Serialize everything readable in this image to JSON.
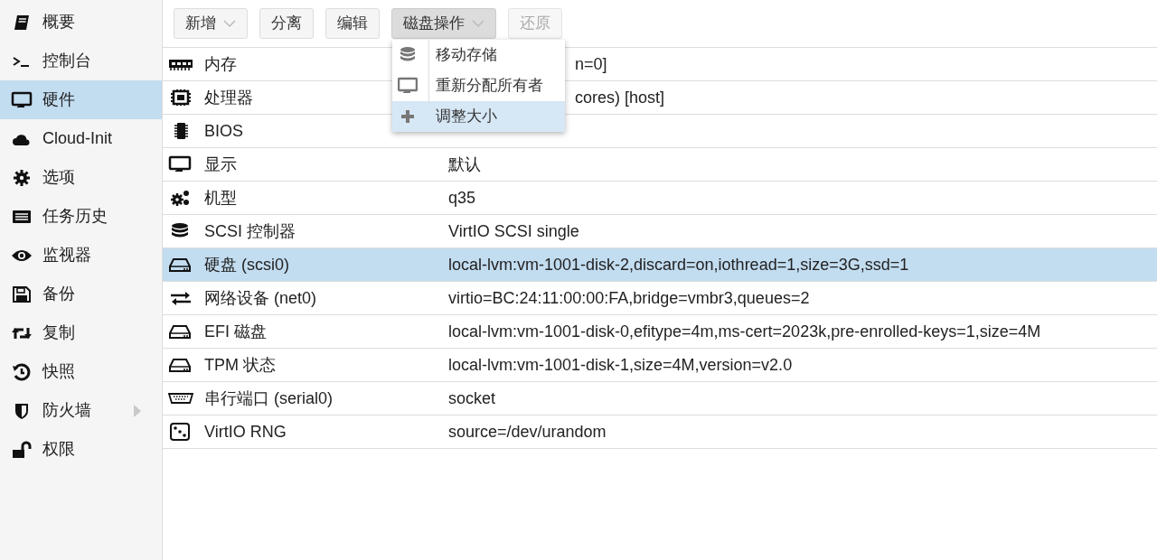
{
  "sidebar": {
    "items": [
      {
        "label": "概要",
        "selected": false,
        "expandable": false
      },
      {
        "label": "控制台",
        "selected": false,
        "expandable": false
      },
      {
        "label": "硬件",
        "selected": true,
        "expandable": false
      },
      {
        "label": "Cloud-Init",
        "selected": false,
        "expandable": false
      },
      {
        "label": "选项",
        "selected": false,
        "expandable": false
      },
      {
        "label": "任务历史",
        "selected": false,
        "expandable": false
      },
      {
        "label": "监视器",
        "selected": false,
        "expandable": false
      },
      {
        "label": "备份",
        "selected": false,
        "expandable": false
      },
      {
        "label": "复制",
        "selected": false,
        "expandable": false
      },
      {
        "label": "快照",
        "selected": false,
        "expandable": false
      },
      {
        "label": "防火墙",
        "selected": false,
        "expandable": true
      },
      {
        "label": "权限",
        "selected": false,
        "expandable": false
      }
    ]
  },
  "toolbar": {
    "buttons": [
      {
        "label": "新增",
        "dropdown": true,
        "expanded": false,
        "disabled": false
      },
      {
        "label": "分离",
        "dropdown": false,
        "expanded": false,
        "disabled": false
      },
      {
        "label": "编辑",
        "dropdown": false,
        "expanded": false,
        "disabled": false
      },
      {
        "label": "磁盘操作",
        "dropdown": true,
        "expanded": true,
        "disabled": false,
        "menu": [
          {
            "label": "移动存储",
            "selected": false
          },
          {
            "label": "重新分配所有者",
            "selected": false
          },
          {
            "label": "调整大小",
            "selected": true
          }
        ]
      },
      {
        "label": "还原",
        "dropdown": false,
        "expanded": false,
        "disabled": true
      }
    ]
  },
  "table": {
    "rows": [
      {
        "label": "内存",
        "value": "n=0]",
        "covered": true,
        "selected": false
      },
      {
        "label": "处理器",
        "value": "cores) [host]",
        "covered": true,
        "selected": false
      },
      {
        "label": "BIOS",
        "selected": false
      },
      {
        "label": "显示",
        "value": "默认",
        "covered": false,
        "selected": false
      },
      {
        "label": "机型",
        "value": "q35",
        "covered": false,
        "selected": false
      },
      {
        "label": "SCSI 控制器",
        "value": "VirtIO SCSI single",
        "covered": false,
        "selected": false
      },
      {
        "label": "硬盘 (scsi0)",
        "value": "local-lvm:vm-1001-disk-2,discard=on,iothread=1,size=3G,ssd=1",
        "covered": false,
        "selected": true
      },
      {
        "label": "网络设备 (net0)",
        "value": "virtio=BC:24:11:00:00:FA,bridge=vmbr3,queues=2",
        "covered": false,
        "selected": false
      },
      {
        "label": "EFI 磁盘",
        "value": "local-lvm:vm-1001-disk-0,efitype=4m,ms-cert=2023k,pre-enrolled-keys=1,size=4M",
        "covered": false,
        "selected": false
      },
      {
        "label": "TPM 状态",
        "value": "local-lvm:vm-1001-disk-1,size=4M,version=v2.0",
        "covered": false,
        "selected": false
      },
      {
        "label": "串行端口 (serial0)",
        "value": "socket",
        "covered": false,
        "selected": false
      },
      {
        "label": "VirtIO RNG",
        "value": "source=/dev/urandom",
        "covered": false,
        "selected": false
      }
    ]
  }
}
